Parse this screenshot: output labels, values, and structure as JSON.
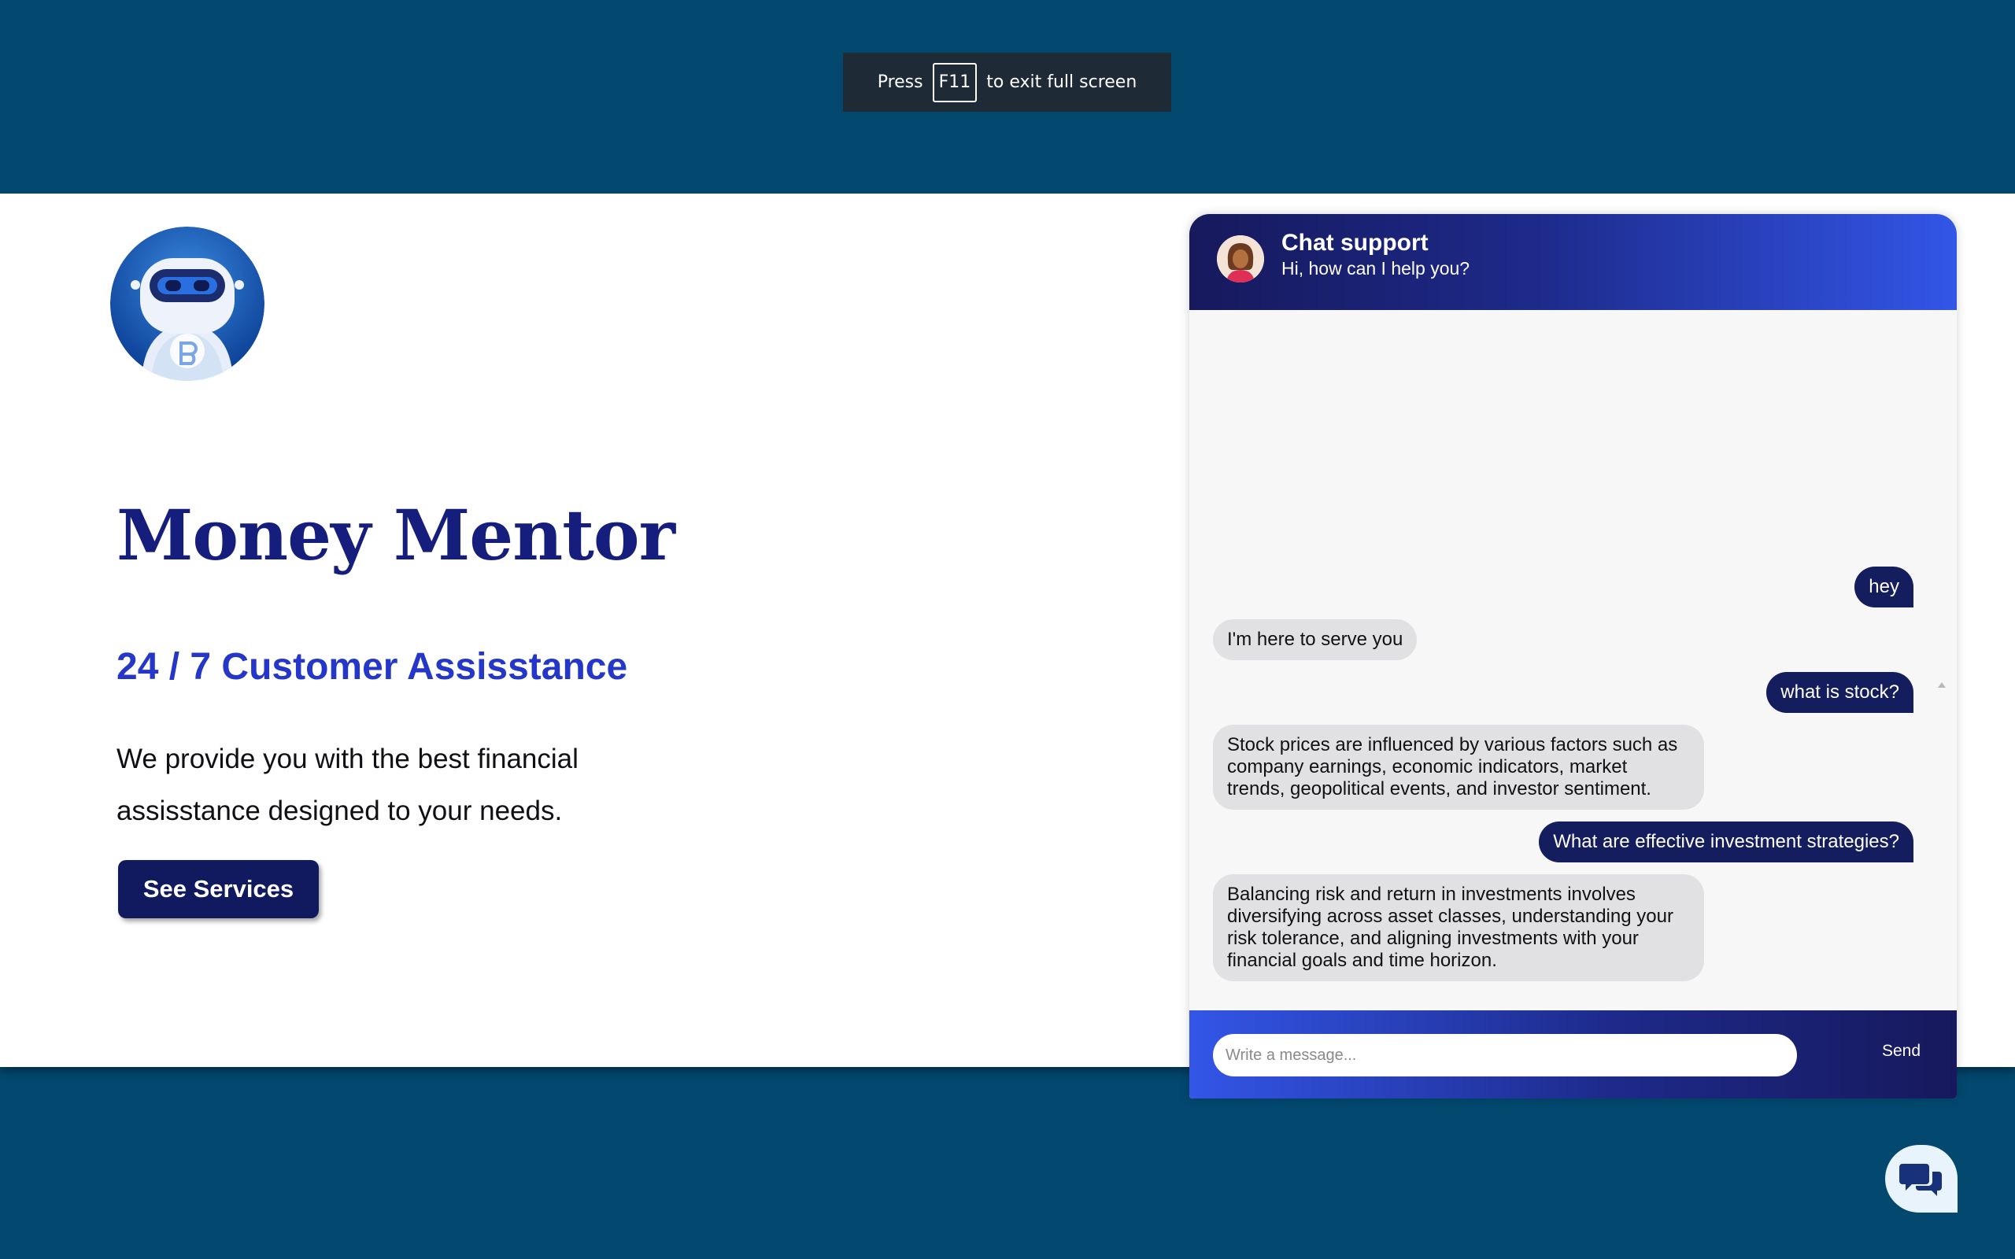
{
  "fullscreen_notice": {
    "press": "Press",
    "key": "F11",
    "rest": "to exit full screen"
  },
  "hero": {
    "title": "Money Mentor",
    "subtitle": "24 / 7 Customer Assisstance",
    "description": "We provide you with the best financial assisstance designed to your needs.",
    "cta_label": "See Services"
  },
  "chat": {
    "title": "Chat support",
    "subtitle": "Hi, how can I help you?",
    "messages": [
      {
        "from": "user",
        "text": "hey"
      },
      {
        "from": "bot",
        "text": "I'm here to serve you"
      },
      {
        "from": "user",
        "text": "what is stock?"
      },
      {
        "from": "bot",
        "text": "Stock prices are influenced by various factors such as company earnings, economic indicators, market trends, geopolitical events, and investor sentiment."
      },
      {
        "from": "user",
        "text": "What are effective investment strategies?"
      },
      {
        "from": "bot",
        "text": "Balancing risk and return in investments involves diversifying across asset classes, understanding your risk tolerance, and aligning investments with your financial goals and time horizon."
      }
    ],
    "input_placeholder": "Write a message...",
    "send_label": "Send"
  },
  "colors": {
    "page_background": "#03486f",
    "brand_navy": "#151e7c",
    "accent_blue": "#2537c8",
    "chat_gradient_light": "#3356e8",
    "chat_gradient_dark": "#17195c"
  },
  "icons": {
    "logo": "robot-mascot-logo",
    "chat_avatar": "support-agent-avatar",
    "chat_launcher": "chat-bubbles-icon"
  }
}
